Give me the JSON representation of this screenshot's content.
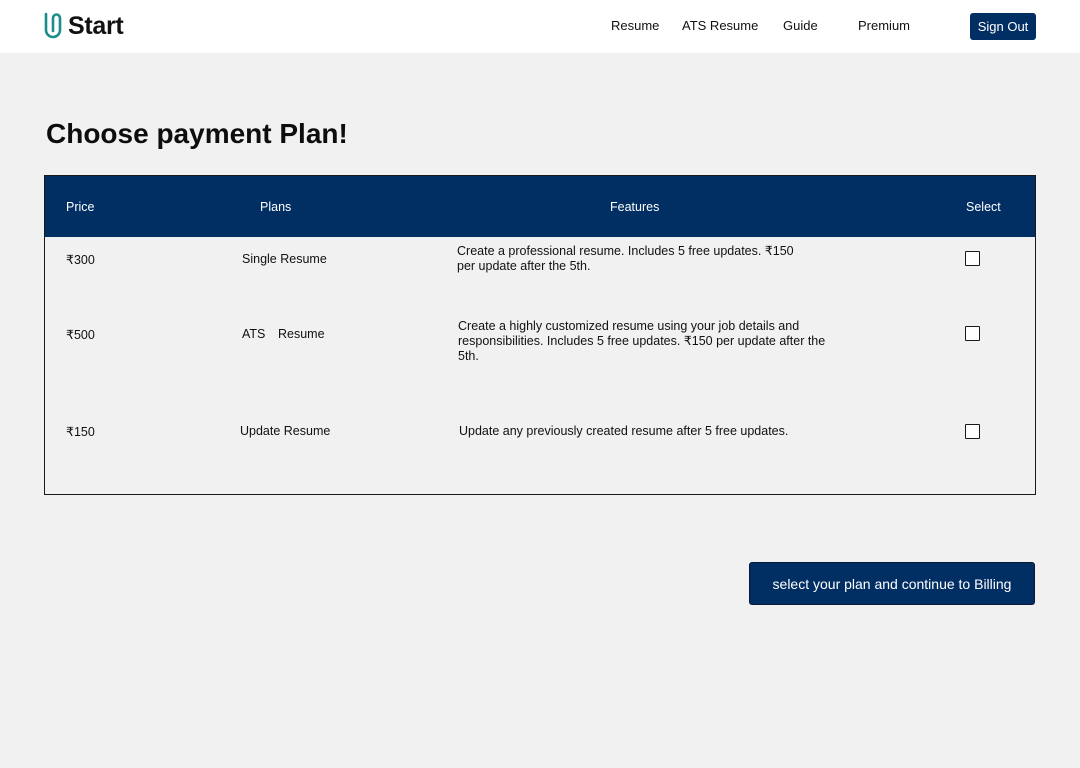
{
  "brand": {
    "name": "Start",
    "icon": "paperclip-u-logo",
    "accent": "#1a8f8a"
  },
  "nav": {
    "resume": "Resume",
    "ats_resume": "ATS Resume",
    "guide": "Guide",
    "premium": "Premium",
    "sign_out": "Sign Out"
  },
  "page_title": "Choose payment Plan!",
  "table": {
    "headers": {
      "price": "Price",
      "plans": "Plans",
      "features": "Features",
      "select": "Select"
    },
    "rows": [
      {
        "price": "₹300",
        "plan": "Single Resume",
        "features": "Create a professional resume. Includes 5 free updates. ₹150 per update after the 5th.",
        "selected": false
      },
      {
        "price": "₹500",
        "plan_a": "ATS",
        "plan_b": "Resume",
        "features": "Create a highly customized resume using your job details and responsibilities. Includes 5 free updates. ₹150 per update after the 5th.",
        "selected": false
      },
      {
        "price": "₹150",
        "plan": "Update Resume",
        "features": "Update any previously created resume after 5 free updates.",
        "selected": false
      }
    ]
  },
  "continue_button": "select your plan and continue to Billing",
  "colors": {
    "primary": "#012e63",
    "background": "#f1f1f1",
    "header_bg": "#ffffff"
  }
}
